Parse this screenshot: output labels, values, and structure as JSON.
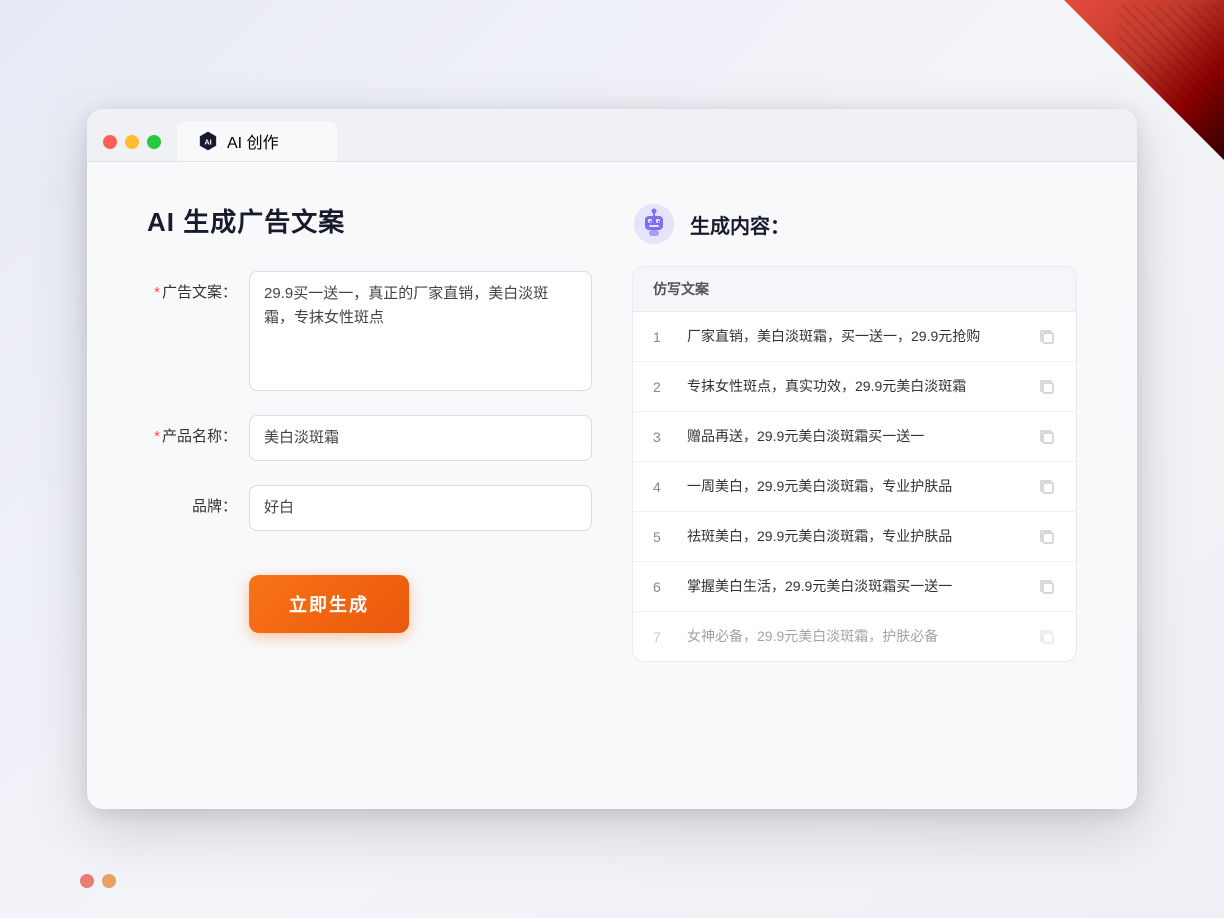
{
  "window": {
    "title": "AI 创作",
    "tab_label": "AI 创作",
    "controls": {
      "close": "close",
      "minimize": "minimize",
      "maximize": "maximize"
    }
  },
  "page": {
    "title": "AI 生成广告文案"
  },
  "form": {
    "ad_copy_label": "广告文案：",
    "ad_copy_required": "*",
    "ad_copy_value": "29.9买一送一，真正的厂家直销，美白淡斑霜，专抹女性斑点",
    "product_name_label": "产品名称：",
    "product_name_required": "*",
    "product_name_value": "美白淡斑霜",
    "brand_label": "品牌：",
    "brand_value": "好白",
    "generate_btn": "立即生成"
  },
  "results": {
    "panel_title": "生成内容：",
    "column_header": "仿写文案",
    "items": [
      {
        "num": "1",
        "text": "厂家直销，美白淡斑霜，买一送一，29.9元抢购",
        "faded": false
      },
      {
        "num": "2",
        "text": "专抹女性斑点，真实功效，29.9元美白淡斑霜",
        "faded": false
      },
      {
        "num": "3",
        "text": "赠品再送，29.9元美白淡斑霜买一送一",
        "faded": false
      },
      {
        "num": "4",
        "text": "一周美白，29.9元美白淡斑霜，专业护肤品",
        "faded": false
      },
      {
        "num": "5",
        "text": "祛斑美白，29.9元美白淡斑霜，专业护肤品",
        "faded": false
      },
      {
        "num": "6",
        "text": "掌握美白生活，29.9元美白淡斑霜买一送一",
        "faded": false
      },
      {
        "num": "7",
        "text": "女神必备，29.9元美白淡斑霜，护肤必备",
        "faded": true
      }
    ]
  },
  "colors": {
    "accent_orange": "#f97316",
    "accent_purple": "#7c6ef5",
    "required_red": "#ff4d4f"
  }
}
